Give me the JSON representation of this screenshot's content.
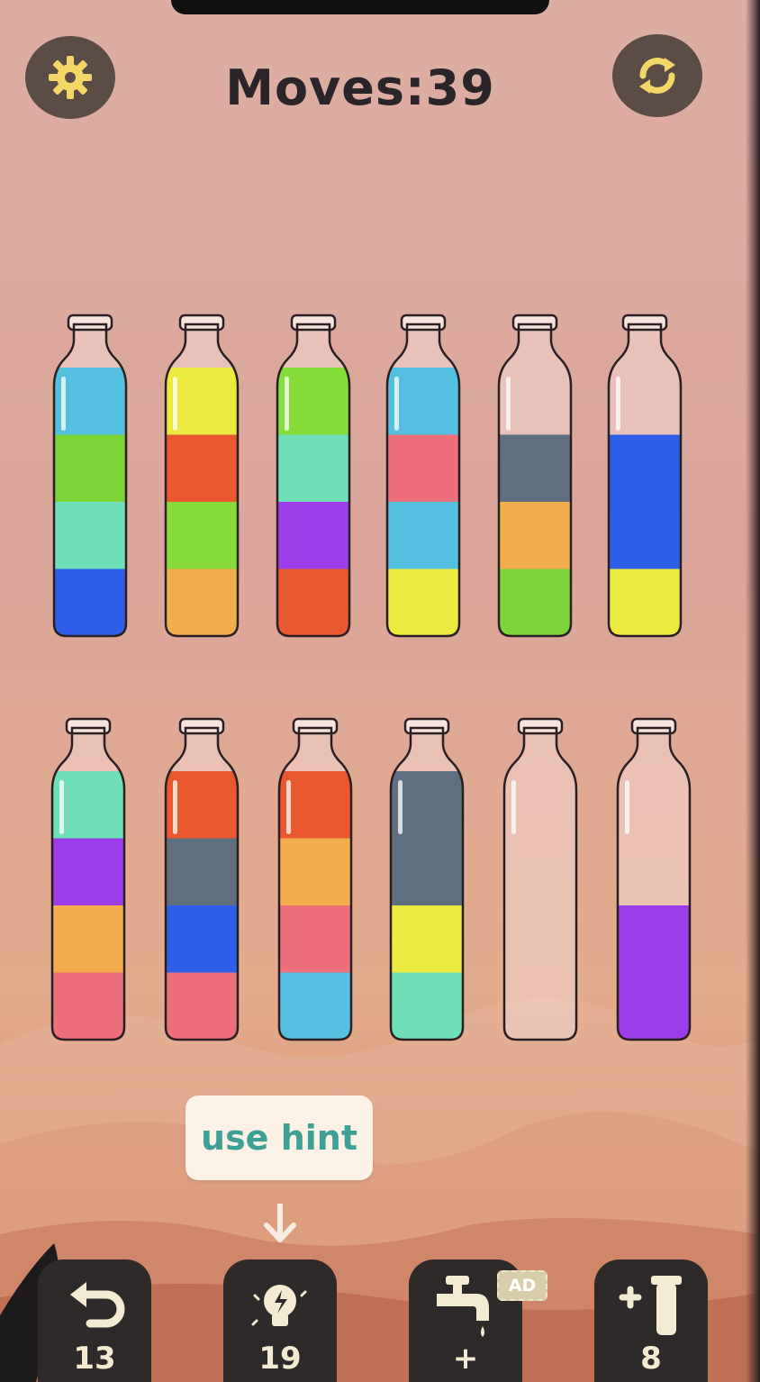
{
  "header": {
    "moves_label": "Moves:39",
    "settings_icon": "gear-icon",
    "restart_icon": "restart-arrows-icon"
  },
  "bottles": {
    "row1": [
      {
        "layers_top_to_bottom": [
          "#55bfe0",
          "#7dd33a",
          "#6fe0b8",
          "#2f5fe8"
        ]
      },
      {
        "layers_top_to_bottom": [
          "#ece93f",
          "#e9582f",
          "#86dc39",
          "#f3ad4b"
        ]
      },
      {
        "layers_top_to_bottom": [
          "#86dc39",
          "#6fe0b8",
          "#9b3ee9",
          "#e9582f"
        ]
      },
      {
        "layers_top_to_bottom": [
          "#55bfe0",
          "#ec6f7a",
          "#55bfe0",
          "#ece93f"
        ]
      },
      {
        "layers_top_to_bottom": [
          "#5f6f7f",
          "#f3ad4b",
          "#7dd33a"
        ]
      },
      {
        "layers_top_to_bottom": [
          "#2f5fe8",
          "#2f5fe8",
          "#ece93f"
        ]
      }
    ],
    "row2": [
      {
        "layers_top_to_bottom": [
          "#6fe0b8",
          "#9b3ee9",
          "#f3ad4b",
          "#ec6f7a"
        ]
      },
      {
        "layers_top_to_bottom": [
          "#e9582f",
          "#5f6f7f",
          "#2f5fe8",
          "#ec6f7a"
        ]
      },
      {
        "layers_top_to_bottom": [
          "#e9582f",
          "#f3ad4b",
          "#ec6f7a",
          "#55bfe0"
        ]
      },
      {
        "layers_top_to_bottom": [
          "#5f6f7f",
          "#5f6f7f",
          "#ece93f",
          "#6fe0b8"
        ]
      },
      {
        "layers_top_to_bottom": []
      },
      {
        "layers_top_to_bottom": [
          "#9b3ee9",
          "#9b3ee9"
        ]
      }
    ]
  },
  "hint": {
    "label": "use hint",
    "arrow_icon": "arrow-down-icon"
  },
  "toolbar": {
    "undo": {
      "icon": "undo-icon",
      "count": "13"
    },
    "hint": {
      "icon": "lightbulb-icon",
      "count": "19"
    },
    "tap": {
      "icon": "faucet-icon",
      "count": "+",
      "badge": "AD"
    },
    "add_tube": {
      "icon": "add-tube-icon",
      "count": "8"
    }
  },
  "colors": {
    "background": "#dcaea2",
    "button_dark": "#2f2a2a",
    "hint_text": "#3fa096"
  }
}
